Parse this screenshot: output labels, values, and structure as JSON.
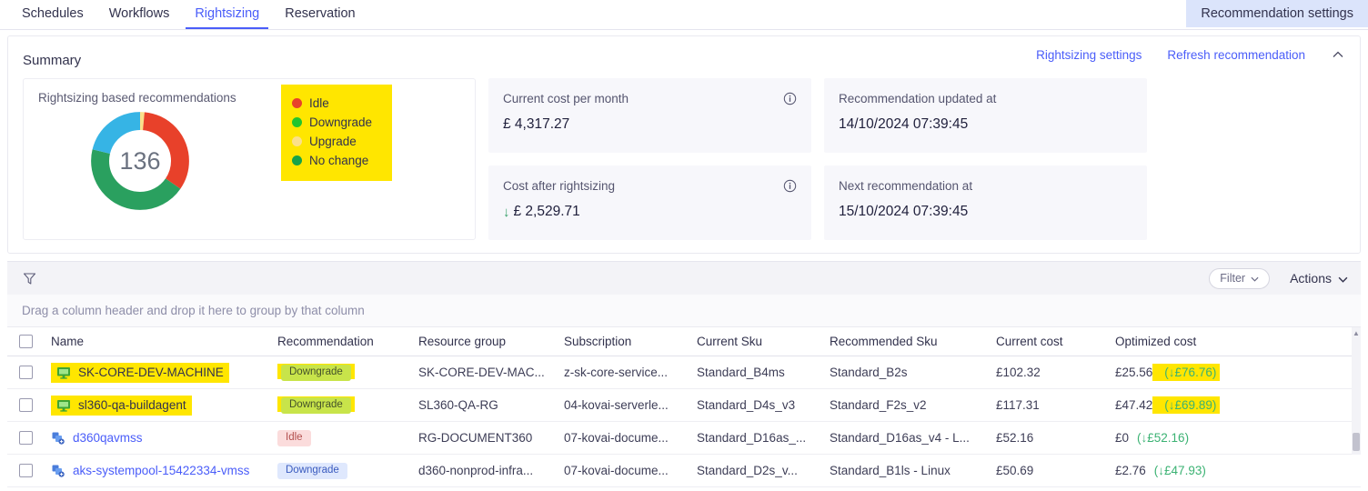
{
  "tabs": [
    {
      "label": "Schedules",
      "active": false
    },
    {
      "label": "Workflows",
      "active": false
    },
    {
      "label": "Rightsizing",
      "active": true
    },
    {
      "label": "Reservation",
      "active": false
    }
  ],
  "header": {
    "recommendation_settings_label": "Recommendation settings"
  },
  "summary": {
    "title": "Summary",
    "rightsizing_settings_label": "Rightsizing settings",
    "refresh_recommendation_label": "Refresh recommendation",
    "collapse_icon": "chevron-up-icon"
  },
  "chart_data": {
    "type": "pie",
    "title": "Rightsizing based recommendations",
    "center_total": "136",
    "total": 136,
    "categories": [
      "Idle",
      "Downgrade",
      "Upgrade",
      "No change"
    ],
    "values": [
      45,
      60,
      2,
      29
    ],
    "colors": [
      "#e8412a",
      "#2aa05f",
      "#fbe08a",
      "#36b4e5"
    ],
    "legend_colors": [
      "#e8412a",
      "#22c52e",
      "#fbe08a",
      "#16a34a"
    ],
    "legend_position": "right",
    "legend_highlight": "#ffe600"
  },
  "stats": [
    {
      "label": "Current cost per month",
      "value": "£ 4,317.27",
      "has_arrow": false,
      "info_icon": "info-icon"
    },
    {
      "label": "Recommendation updated at",
      "value": "14/10/2024 07:39:45",
      "has_arrow": false,
      "info_icon": ""
    },
    {
      "label": "Cost after rightsizing",
      "value": "£ 2,529.71",
      "has_arrow": true,
      "info_icon": "info-icon"
    },
    {
      "label": "Next recommendation at",
      "value": "15/10/2024 07:39:45",
      "has_arrow": false,
      "info_icon": ""
    }
  ],
  "toolbar": {
    "filter_icon": "funnel-icon",
    "filter_label": "Filter",
    "actions_label": "Actions",
    "group_hint": "Drag a column header and drop it here to group by that column"
  },
  "table": {
    "columns": [
      "Name",
      "Recommendation",
      "Resource group",
      "Subscription",
      "Current Sku",
      "Recommended Sku",
      "Current cost",
      "Optimized cost"
    ],
    "rows": [
      {
        "name": "SK-CORE-DEV-MACHINE",
        "icon": "virtual-machine-icon",
        "name_highlighted": true,
        "name_is_link": false,
        "recommendation": "Downgrade",
        "badge_style": "downgrade-highlight",
        "resource_group": "SK-CORE-DEV-MAC...",
        "subscription": "z-sk-core-service...",
        "current_sku": "Standard_B4ms",
        "recommended_sku": "Standard_B2s",
        "current_cost": "£102.32",
        "optimized_cost": "£25.56",
        "savings": "(↓£76.76)",
        "savings_highlighted": true
      },
      {
        "name": "sl360-qa-buildagent",
        "icon": "virtual-machine-icon",
        "name_highlighted": true,
        "name_is_link": false,
        "recommendation": "Downgrade",
        "badge_style": "downgrade-highlight",
        "resource_group": "SL360-QA-RG",
        "subscription": "04-kovai-serverle...",
        "current_sku": "Standard_D4s_v3",
        "recommended_sku": "Standard_F2s_v2",
        "current_cost": "£117.31",
        "optimized_cost": "£47.42",
        "savings": "(↓£69.89)",
        "savings_highlighted": true
      },
      {
        "name": "d360qavmss",
        "icon": "vmss-icon",
        "name_highlighted": false,
        "name_is_link": true,
        "recommendation": "Idle",
        "badge_style": "idle",
        "resource_group": "RG-DOCUMENT360",
        "subscription": "07-kovai-docume...",
        "current_sku": "Standard_D16as_...",
        "recommended_sku": "Standard_D16as_v4 - L...",
        "current_cost": "£52.16",
        "optimized_cost": "£0",
        "savings": "(↓£52.16)",
        "savings_highlighted": false
      },
      {
        "name": "aks-systempool-15422334-vmss",
        "icon": "vmss-icon",
        "name_highlighted": false,
        "name_is_link": true,
        "recommendation": "Downgrade",
        "badge_style": "downgrade",
        "resource_group": "d360-nonprod-infra...",
        "subscription": "07-kovai-docume...",
        "current_sku": "Standard_D2s_v...",
        "recommended_sku": "Standard_B1ls - Linux",
        "current_cost": "£50.69",
        "optimized_cost": "£2.76",
        "savings": "(↓£47.93)",
        "savings_highlighted": false
      }
    ]
  },
  "colors": {
    "accent": "#4a5df9",
    "highlight": "#ffe600",
    "savings_green": "#3bb273",
    "idle_red": "#e8412a"
  }
}
